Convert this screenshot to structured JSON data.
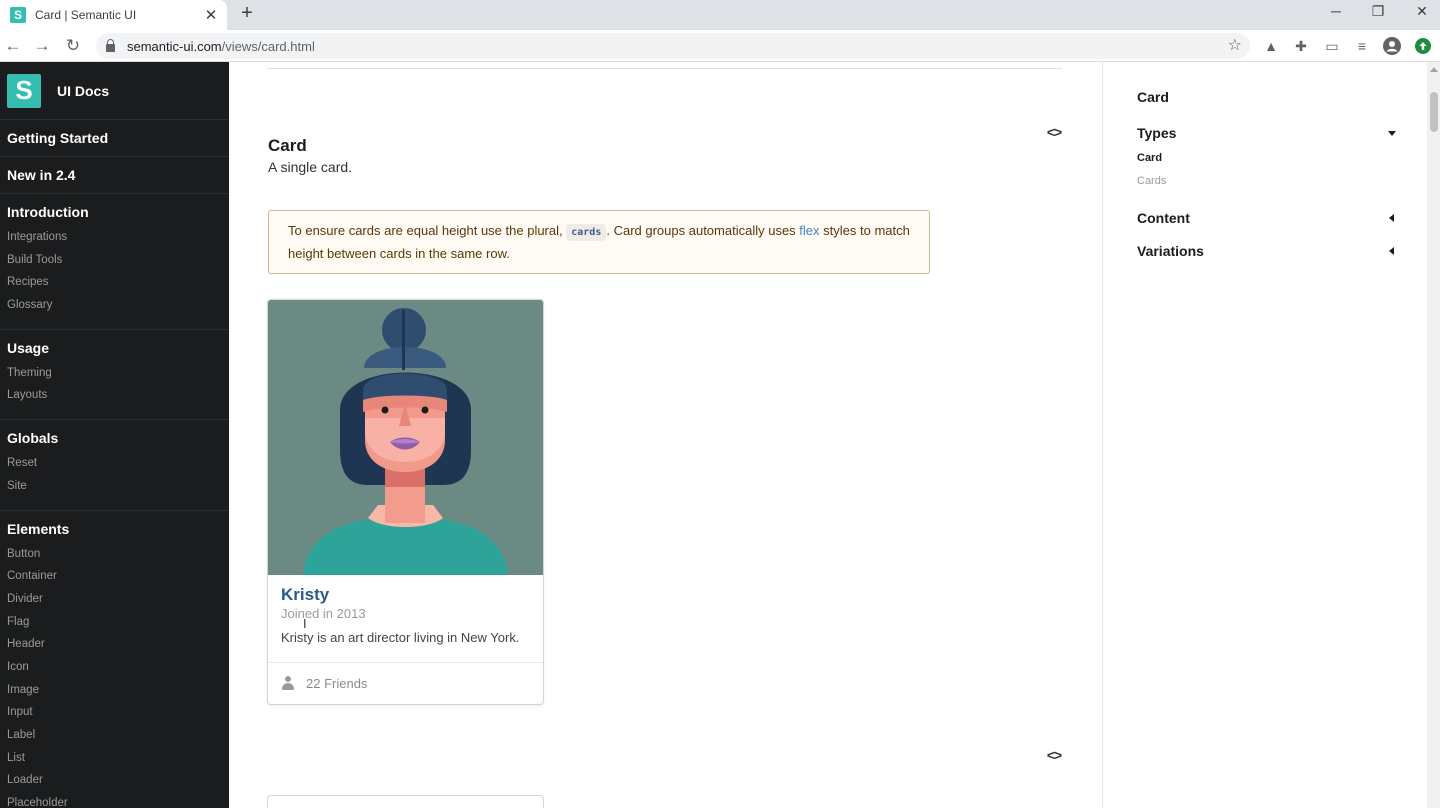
{
  "browser": {
    "tab_title": "Card | Semantic UI",
    "favicon_letter": "S",
    "url_host": "semantic-ui.com",
    "url_path": "/views/card.html",
    "icons": [
      "back-icon",
      "forward-icon",
      "reload-icon",
      "lock-icon",
      "star-icon",
      "drive-icon",
      "extensions-icon",
      "cast-icon",
      "media-icon",
      "profile-icon",
      "update-icon"
    ]
  },
  "sidebar": {
    "logo_letter": "S",
    "brand": "UI Docs",
    "singles": [
      "Getting Started",
      "New in 2.4"
    ],
    "sections": [
      {
        "title": "Introduction",
        "items": [
          "Integrations",
          "Build Tools",
          "Recipes",
          "Glossary"
        ]
      },
      {
        "title": "Usage",
        "items": [
          "Theming",
          "Layouts"
        ]
      },
      {
        "title": "Globals",
        "items": [
          "Reset",
          "Site"
        ]
      },
      {
        "title": "Elements",
        "items": [
          "Button",
          "Container",
          "Divider",
          "Flag",
          "Header",
          "Icon",
          "Image",
          "Input",
          "Label",
          "List",
          "Loader",
          "Placeholder"
        ]
      }
    ]
  },
  "main": {
    "example_title": "Card",
    "example_desc": "A single card.",
    "code_toggle": "<>",
    "note": {
      "before": "To ensure cards are equal height use the plural,",
      "code": "cards",
      "middle": ". Card groups automatically uses",
      "link": "flex",
      "after": "styles to match height between cards in the same row."
    },
    "card": {
      "name": "Kristy",
      "meta": "Joined in 2013",
      "description": "Kristy is an art director living in New York.",
      "extra": "22 Friends",
      "extra_icon": "user-icon",
      "image_bg": "#6b8a83"
    }
  },
  "toc": {
    "title": "Card",
    "sections": [
      {
        "label": "Types",
        "expanded": true,
        "items": [
          {
            "label": "Card",
            "active": true
          },
          {
            "label": "Cards",
            "active": false
          }
        ]
      },
      {
        "label": "Content",
        "expanded": false
      },
      {
        "label": "Variations",
        "expanded": false
      }
    ]
  },
  "colors": {
    "brand_teal": "#35bdb2",
    "sidebar_bg": "#1b1c1d",
    "link_blue": "#4183c4",
    "card_header": "#2a5a86",
    "note_bg": "#fffaf3"
  }
}
